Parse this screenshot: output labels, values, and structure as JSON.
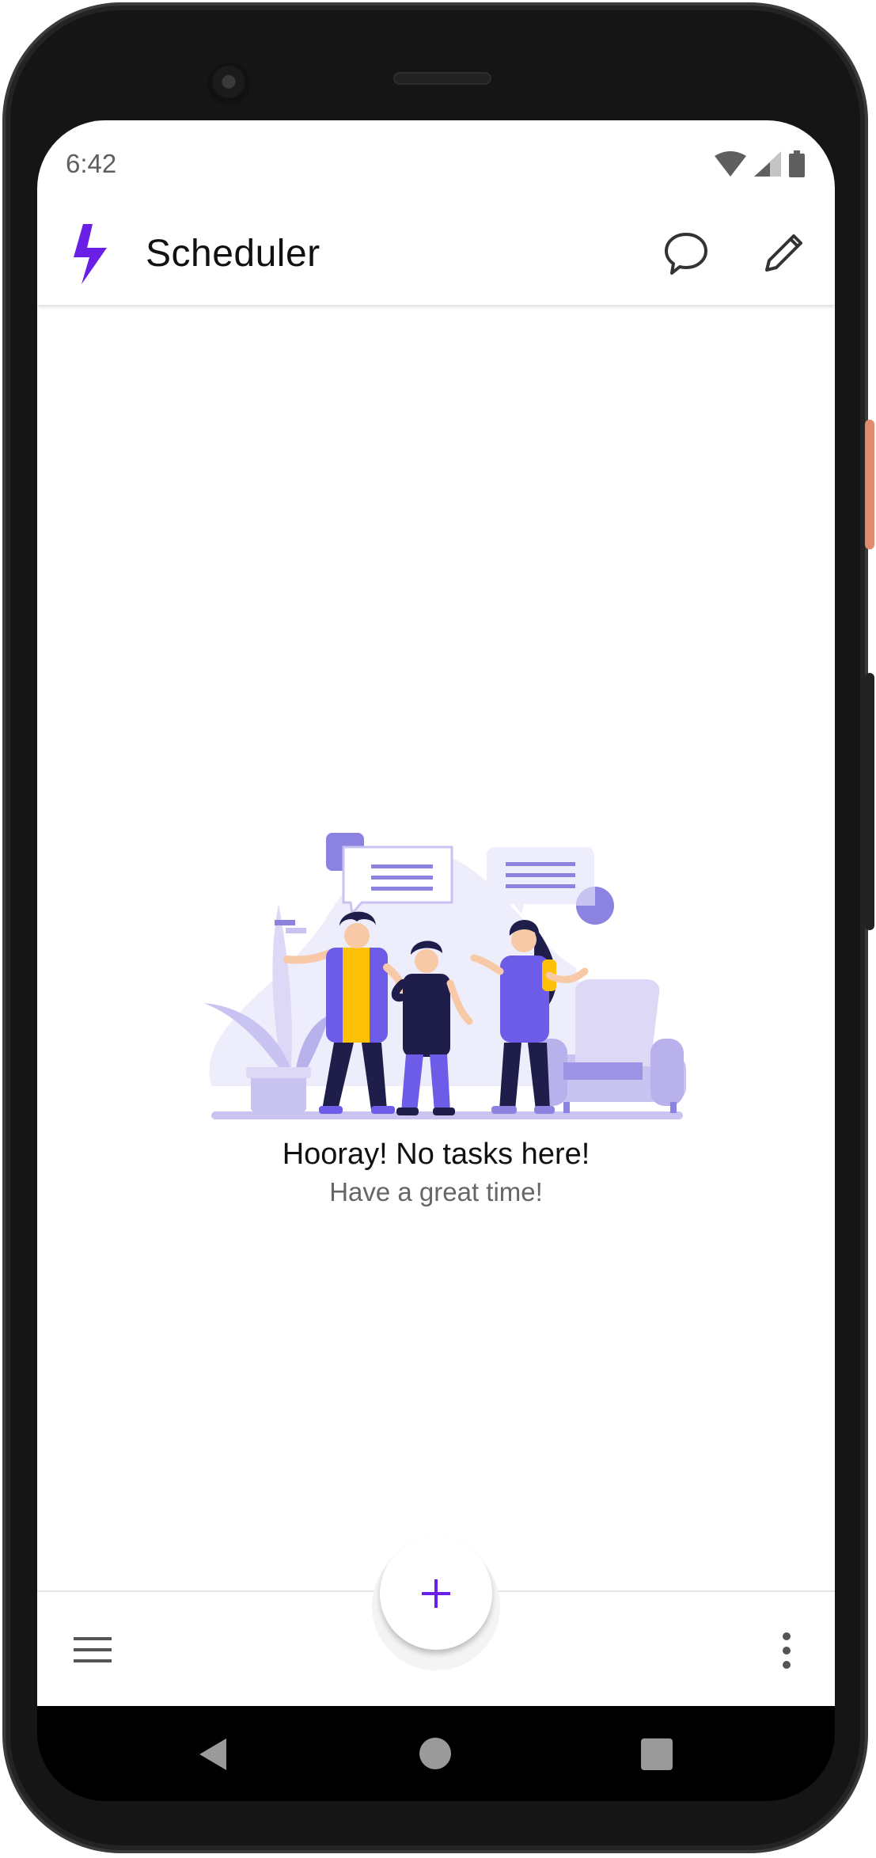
{
  "status_bar": {
    "time": "6:42",
    "icons": [
      "wifi-icon",
      "cellular-icon",
      "battery-icon"
    ]
  },
  "app_bar": {
    "title": "Scheduler",
    "logo_icon": "lightning-bolt-icon",
    "actions": [
      "chat-bubble-icon",
      "pencil-icon"
    ]
  },
  "empty_state": {
    "illustration": "people-chatting-illustration",
    "title": "Hooray! No tasks here!",
    "subtitle": "Have a great time!"
  },
  "bottom_bar": {
    "menu_icon": "hamburger-menu-icon",
    "fab_icon": "plus-icon",
    "overflow_icon": "more-vert-icon"
  },
  "nav_bar": {
    "icons": [
      "back-icon",
      "home-icon",
      "recents-icon"
    ]
  },
  "colors": {
    "accent": "#6a1fe6",
    "illustration_primary": "#6c5ce7",
    "illustration_light": "#c8c3f0",
    "illustration_yellow": "#ffc107",
    "illustration_dark": "#1f1d4a"
  }
}
